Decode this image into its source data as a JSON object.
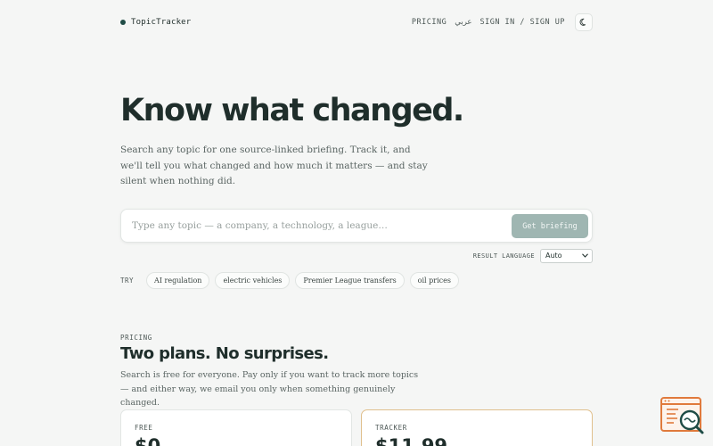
{
  "nav": {
    "brand": "TopicTracker",
    "pricing": "PRICING",
    "arabic": "عربي",
    "sign_in": "SIGN IN",
    "separator": "/",
    "sign_up": "SIGN UP",
    "theme_icon": "moon-icon"
  },
  "hero": {
    "title": "Know what changed.",
    "subtitle": "Search any topic for one source-linked briefing. Track it, and we'll tell you what changed and how much it matters — and stay silent when nothing did."
  },
  "search": {
    "placeholder": "Type any topic — a company, a technology, a league…",
    "value": "",
    "button": "Get briefing"
  },
  "language": {
    "label": "RESULT LANGUAGE",
    "selected": "Auto"
  },
  "try": {
    "label": "TRY",
    "chips": [
      "AI regulation",
      "electric vehicles",
      "Premier League transfers",
      "oil prices"
    ]
  },
  "pricing": {
    "eyebrow": "PRICING",
    "title": "Two plans. No surprises.",
    "subtitle": "Search is free for everyone. Pay only if you want to track more topics — and either way, we email you only when something genuinely changed.",
    "plans": [
      {
        "name": "FREE",
        "price": "$0"
      },
      {
        "name": "TRACKER",
        "price": "$11.99"
      }
    ]
  },
  "colors": {
    "accent": "#1f4c46",
    "button": "#9fb6b2",
    "highlight_border": "#e0c08d",
    "floating_icon": "#e07a3c"
  }
}
